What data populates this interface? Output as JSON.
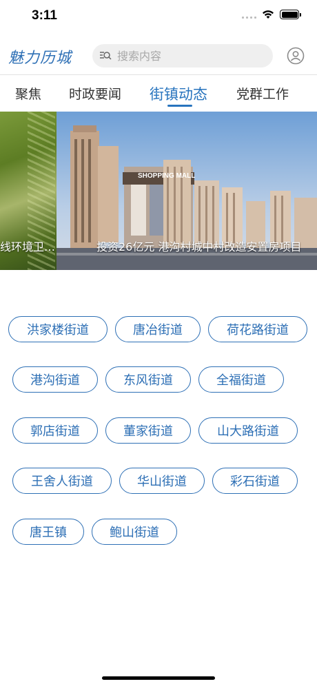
{
  "status_bar": {
    "time": "3:11"
  },
  "header": {
    "logo": "魅力历城",
    "search_placeholder": "搜索内容"
  },
  "tabs": [
    {
      "label": "聚焦",
      "active": false
    },
    {
      "label": "时政要闻",
      "active": false
    },
    {
      "label": "街镇动态",
      "active": true
    },
    {
      "label": "党群工作",
      "active": false
    }
  ],
  "banner": {
    "prev_caption": "线环境卫…",
    "main_caption": "投资26亿元 港沟村城中村改造安置房项目",
    "mall_sign": "SHOPPING MALL"
  },
  "streets": [
    "洪家楼街道",
    "唐冶街道",
    "荷花路街道",
    "港沟街道",
    "东风街道",
    "全福街道",
    "郭店街道",
    "董家街道",
    "山大路街道",
    "王舍人街道",
    "华山街道",
    "彩石街道",
    "唐王镇",
    "鲍山街道"
  ],
  "colors": {
    "accent": "#2874be",
    "pill_border": "#2d6fb5"
  }
}
